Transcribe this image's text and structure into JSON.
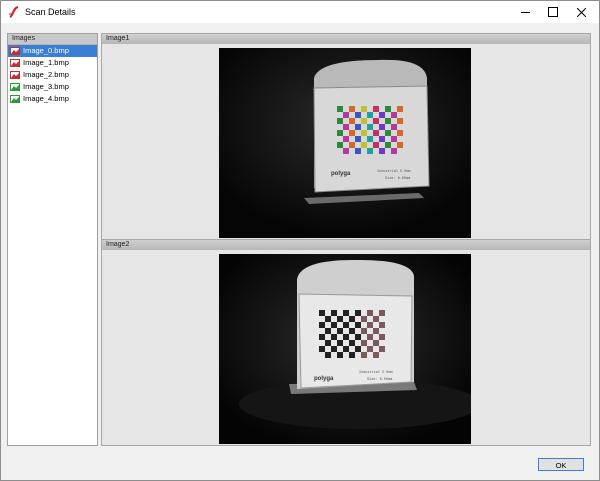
{
  "window": {
    "title": "Scan Details",
    "controls": [
      "minimize",
      "maximize",
      "close"
    ]
  },
  "images_panel": {
    "header": "Images",
    "selected_index": 0,
    "items": [
      {
        "label": "Image_0.bmp",
        "status": "error",
        "icon": "image-error-icon"
      },
      {
        "label": "Image_1.bmp",
        "status": "error",
        "icon": "image-error-icon"
      },
      {
        "label": "Image_2.bmp",
        "status": "error",
        "icon": "image-error-icon"
      },
      {
        "label": "Image_3.bmp",
        "status": "ok",
        "icon": "image-ok-icon"
      },
      {
        "label": "Image_4.bmp",
        "status": "ok",
        "icon": "image-ok-icon"
      }
    ]
  },
  "views": [
    {
      "label": "Image1",
      "board_text": "polyga",
      "tag_line1": "Industrial 5.0mm",
      "tag_line2": "Size: 6.00mm"
    },
    {
      "label": "Image2",
      "board_text": "polyga",
      "tag_line1": "Industrial 5.0mm",
      "tag_line2": "Size: 6.00mm"
    }
  ],
  "footer": {
    "ok_label": "OK"
  },
  "colors": {
    "selection": "#3a7fd5",
    "error_icon": "#c03030",
    "ok_icon": "#2f9a3a"
  }
}
